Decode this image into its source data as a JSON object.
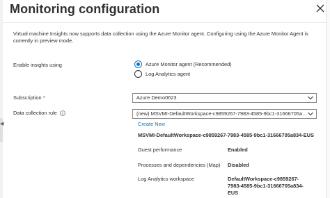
{
  "panel": {
    "title": "Monitoring configuration",
    "info_text": "Virtual machine Insights now supports data collection using the Azure Monitor agent. Configuring using the Azure Monitor Agent is currently in preview mode."
  },
  "enable_insights": {
    "label": "Enable insights using",
    "options": [
      {
        "label": "Azure Monitor agent (Recommended)",
        "selected": true
      },
      {
        "label": "Log Analytics agent",
        "selected": false
      }
    ]
  },
  "subscription": {
    "label": "Subscription",
    "required_mark": "*",
    "value": "Azure Demo0623"
  },
  "data_collection_rule": {
    "label": "Data collection rule",
    "value": "(new) MSVMI-DefaultWorkspace-c9859267-7983-4585-9bc1-31666705a834-EUS",
    "create_new_label": "Create New",
    "rule_name": "MSVMI-DefaultWorkspace-c9859267-7983-4585-9bc1-31666705a834-EUS",
    "details": [
      {
        "label": "Guest performance",
        "value": "Enabled"
      },
      {
        "label": "Processes and dependencies (Map)",
        "value": "Disabled"
      },
      {
        "label": "Log Analytics workspace",
        "value": "DefaultWorkspace-c9859267-7983-4585-9bc1-31666705a834-EUS"
      }
    ]
  },
  "icons": {
    "close": "close-icon",
    "info": "info-icon",
    "dropdown": "chevron-down-icon"
  },
  "colors": {
    "accent": "#0078d4",
    "required": "#a4262c",
    "text": "#323130"
  }
}
